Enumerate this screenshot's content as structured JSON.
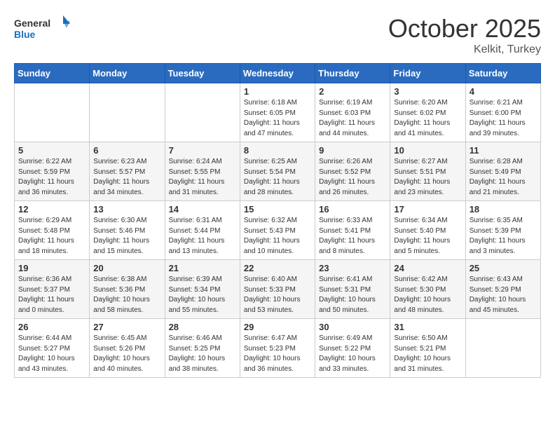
{
  "header": {
    "logo_general": "General",
    "logo_blue": "Blue",
    "month": "October 2025",
    "location": "Kelkit, Turkey"
  },
  "days_of_week": [
    "Sunday",
    "Monday",
    "Tuesday",
    "Wednesday",
    "Thursday",
    "Friday",
    "Saturday"
  ],
  "weeks": [
    [
      {
        "day": "",
        "info": ""
      },
      {
        "day": "",
        "info": ""
      },
      {
        "day": "",
        "info": ""
      },
      {
        "day": "1",
        "info": "Sunrise: 6:18 AM\nSunset: 6:05 PM\nDaylight: 11 hours and 47 minutes."
      },
      {
        "day": "2",
        "info": "Sunrise: 6:19 AM\nSunset: 6:03 PM\nDaylight: 11 hours and 44 minutes."
      },
      {
        "day": "3",
        "info": "Sunrise: 6:20 AM\nSunset: 6:02 PM\nDaylight: 11 hours and 41 minutes."
      },
      {
        "day": "4",
        "info": "Sunrise: 6:21 AM\nSunset: 6:00 PM\nDaylight: 11 hours and 39 minutes."
      }
    ],
    [
      {
        "day": "5",
        "info": "Sunrise: 6:22 AM\nSunset: 5:59 PM\nDaylight: 11 hours and 36 minutes."
      },
      {
        "day": "6",
        "info": "Sunrise: 6:23 AM\nSunset: 5:57 PM\nDaylight: 11 hours and 34 minutes."
      },
      {
        "day": "7",
        "info": "Sunrise: 6:24 AM\nSunset: 5:55 PM\nDaylight: 11 hours and 31 minutes."
      },
      {
        "day": "8",
        "info": "Sunrise: 6:25 AM\nSunset: 5:54 PM\nDaylight: 11 hours and 28 minutes."
      },
      {
        "day": "9",
        "info": "Sunrise: 6:26 AM\nSunset: 5:52 PM\nDaylight: 11 hours and 26 minutes."
      },
      {
        "day": "10",
        "info": "Sunrise: 6:27 AM\nSunset: 5:51 PM\nDaylight: 11 hours and 23 minutes."
      },
      {
        "day": "11",
        "info": "Sunrise: 6:28 AM\nSunset: 5:49 PM\nDaylight: 11 hours and 21 minutes."
      }
    ],
    [
      {
        "day": "12",
        "info": "Sunrise: 6:29 AM\nSunset: 5:48 PM\nDaylight: 11 hours and 18 minutes."
      },
      {
        "day": "13",
        "info": "Sunrise: 6:30 AM\nSunset: 5:46 PM\nDaylight: 11 hours and 15 minutes."
      },
      {
        "day": "14",
        "info": "Sunrise: 6:31 AM\nSunset: 5:44 PM\nDaylight: 11 hours and 13 minutes."
      },
      {
        "day": "15",
        "info": "Sunrise: 6:32 AM\nSunset: 5:43 PM\nDaylight: 11 hours and 10 minutes."
      },
      {
        "day": "16",
        "info": "Sunrise: 6:33 AM\nSunset: 5:41 PM\nDaylight: 11 hours and 8 minutes."
      },
      {
        "day": "17",
        "info": "Sunrise: 6:34 AM\nSunset: 5:40 PM\nDaylight: 11 hours and 5 minutes."
      },
      {
        "day": "18",
        "info": "Sunrise: 6:35 AM\nSunset: 5:39 PM\nDaylight: 11 hours and 3 minutes."
      }
    ],
    [
      {
        "day": "19",
        "info": "Sunrise: 6:36 AM\nSunset: 5:37 PM\nDaylight: 11 hours and 0 minutes."
      },
      {
        "day": "20",
        "info": "Sunrise: 6:38 AM\nSunset: 5:36 PM\nDaylight: 10 hours and 58 minutes."
      },
      {
        "day": "21",
        "info": "Sunrise: 6:39 AM\nSunset: 5:34 PM\nDaylight: 10 hours and 55 minutes."
      },
      {
        "day": "22",
        "info": "Sunrise: 6:40 AM\nSunset: 5:33 PM\nDaylight: 10 hours and 53 minutes."
      },
      {
        "day": "23",
        "info": "Sunrise: 6:41 AM\nSunset: 5:31 PM\nDaylight: 10 hours and 50 minutes."
      },
      {
        "day": "24",
        "info": "Sunrise: 6:42 AM\nSunset: 5:30 PM\nDaylight: 10 hours and 48 minutes."
      },
      {
        "day": "25",
        "info": "Sunrise: 6:43 AM\nSunset: 5:29 PM\nDaylight: 10 hours and 45 minutes."
      }
    ],
    [
      {
        "day": "26",
        "info": "Sunrise: 6:44 AM\nSunset: 5:27 PM\nDaylight: 10 hours and 43 minutes."
      },
      {
        "day": "27",
        "info": "Sunrise: 6:45 AM\nSunset: 5:26 PM\nDaylight: 10 hours and 40 minutes."
      },
      {
        "day": "28",
        "info": "Sunrise: 6:46 AM\nSunset: 5:25 PM\nDaylight: 10 hours and 38 minutes."
      },
      {
        "day": "29",
        "info": "Sunrise: 6:47 AM\nSunset: 5:23 PM\nDaylight: 10 hours and 36 minutes."
      },
      {
        "day": "30",
        "info": "Sunrise: 6:49 AM\nSunset: 5:22 PM\nDaylight: 10 hours and 33 minutes."
      },
      {
        "day": "31",
        "info": "Sunrise: 6:50 AM\nSunset: 5:21 PM\nDaylight: 10 hours and 31 minutes."
      },
      {
        "day": "",
        "info": ""
      }
    ]
  ]
}
